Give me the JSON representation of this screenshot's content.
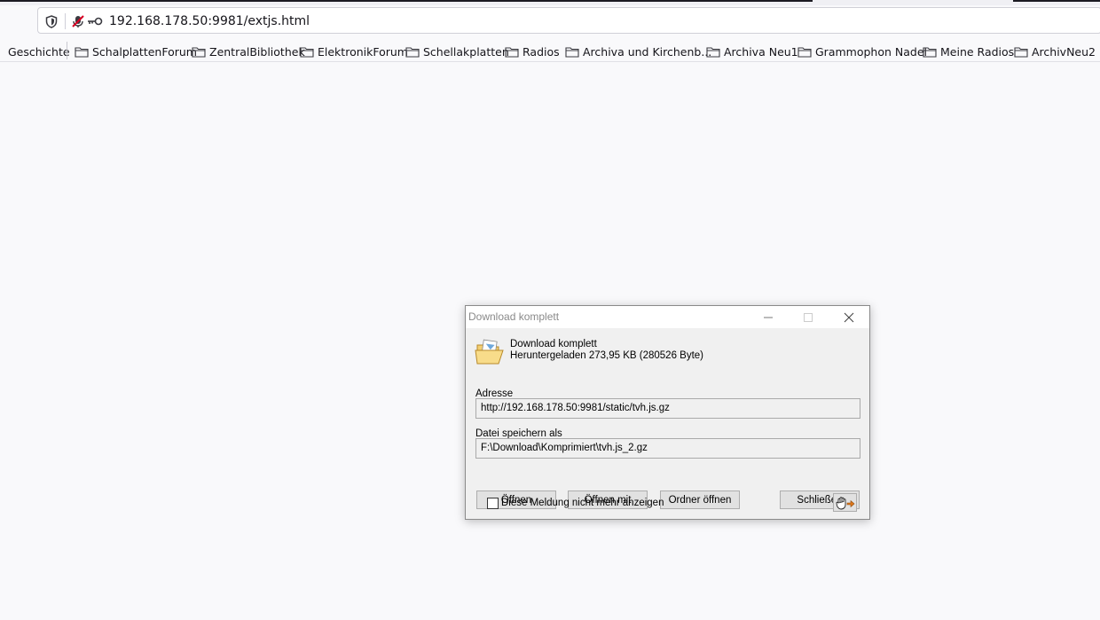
{
  "browser": {
    "url": "192.168.178.50:9981/extjs.html",
    "bookmarks": [
      "Geschichte",
      "SchalplattenForum",
      "ZentralBibliothek",
      "ElektronikForum",
      "Schellakplatten",
      "Radios",
      "Archiva und Kirchenb...",
      "Archiva Neu1",
      "Grammophon Nadel",
      "Meine Radios",
      "ArchivNeu2"
    ]
  },
  "dialog": {
    "title": "Download komplett",
    "message_title": "Download komplett",
    "message_detail": "Heruntergeladen 273,95  KB (280526 Byte)",
    "address_label": "Adresse",
    "address_value": "http://192.168.178.50:9981/static/tvh.js.gz",
    "save_label": "Datei speichern als",
    "save_value": "F:\\Download\\Komprimiert\\tvh.js_2.gz",
    "buttons": {
      "open": "Öffnen",
      "open_with": "Öffnen mit",
      "open_folder": "Ordner öffnen",
      "close": "Schließen"
    },
    "checkbox_label": "Diese Meldung nicht mehr anzeigen",
    "checkbox_checked": false
  },
  "icons": {
    "shield": "shield-icon",
    "no_mic": "microphone-blocked-icon",
    "key": "key-icon",
    "folder": "folder-icon",
    "minimize": "minimize-icon",
    "maximize": "maximize-icon",
    "close": "close-icon",
    "open_folder": "open-folder-icon",
    "hand": "hand-pointer-icon"
  },
  "colors": {
    "page_bg": "#f9f9fb",
    "dialog_bg": "#f0f0f0",
    "button_bg": "#e1e1e1",
    "title_text": "#8a8a8a"
  }
}
